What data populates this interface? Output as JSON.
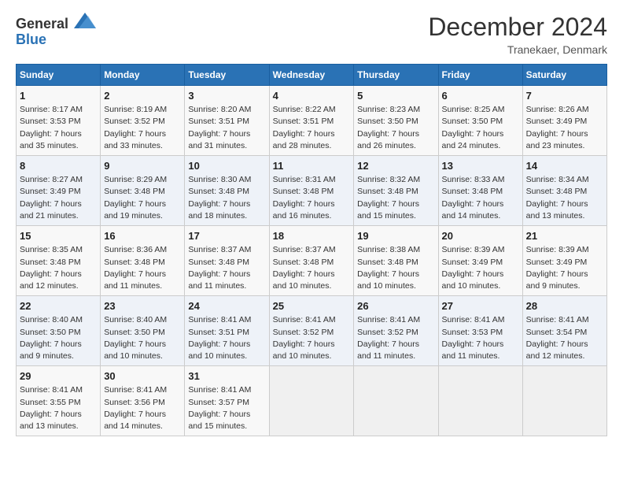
{
  "header": {
    "logo_general": "General",
    "logo_blue": "Blue",
    "month_year": "December 2024",
    "location": "Tranekaer, Denmark"
  },
  "weekdays": [
    "Sunday",
    "Monday",
    "Tuesday",
    "Wednesday",
    "Thursday",
    "Friday",
    "Saturday"
  ],
  "weeks": [
    [
      {
        "day": "1",
        "sunrise": "Sunrise: 8:17 AM",
        "sunset": "Sunset: 3:53 PM",
        "daylight": "Daylight: 7 hours and 35 minutes."
      },
      {
        "day": "2",
        "sunrise": "Sunrise: 8:19 AM",
        "sunset": "Sunset: 3:52 PM",
        "daylight": "Daylight: 7 hours and 33 minutes."
      },
      {
        "day": "3",
        "sunrise": "Sunrise: 8:20 AM",
        "sunset": "Sunset: 3:51 PM",
        "daylight": "Daylight: 7 hours and 31 minutes."
      },
      {
        "day": "4",
        "sunrise": "Sunrise: 8:22 AM",
        "sunset": "Sunset: 3:51 PM",
        "daylight": "Daylight: 7 hours and 28 minutes."
      },
      {
        "day": "5",
        "sunrise": "Sunrise: 8:23 AM",
        "sunset": "Sunset: 3:50 PM",
        "daylight": "Daylight: 7 hours and 26 minutes."
      },
      {
        "day": "6",
        "sunrise": "Sunrise: 8:25 AM",
        "sunset": "Sunset: 3:50 PM",
        "daylight": "Daylight: 7 hours and 24 minutes."
      },
      {
        "day": "7",
        "sunrise": "Sunrise: 8:26 AM",
        "sunset": "Sunset: 3:49 PM",
        "daylight": "Daylight: 7 hours and 23 minutes."
      }
    ],
    [
      {
        "day": "8",
        "sunrise": "Sunrise: 8:27 AM",
        "sunset": "Sunset: 3:49 PM",
        "daylight": "Daylight: 7 hours and 21 minutes."
      },
      {
        "day": "9",
        "sunrise": "Sunrise: 8:29 AM",
        "sunset": "Sunset: 3:48 PM",
        "daylight": "Daylight: 7 hours and 19 minutes."
      },
      {
        "day": "10",
        "sunrise": "Sunrise: 8:30 AM",
        "sunset": "Sunset: 3:48 PM",
        "daylight": "Daylight: 7 hours and 18 minutes."
      },
      {
        "day": "11",
        "sunrise": "Sunrise: 8:31 AM",
        "sunset": "Sunset: 3:48 PM",
        "daylight": "Daylight: 7 hours and 16 minutes."
      },
      {
        "day": "12",
        "sunrise": "Sunrise: 8:32 AM",
        "sunset": "Sunset: 3:48 PM",
        "daylight": "Daylight: 7 hours and 15 minutes."
      },
      {
        "day": "13",
        "sunrise": "Sunrise: 8:33 AM",
        "sunset": "Sunset: 3:48 PM",
        "daylight": "Daylight: 7 hours and 14 minutes."
      },
      {
        "day": "14",
        "sunrise": "Sunrise: 8:34 AM",
        "sunset": "Sunset: 3:48 PM",
        "daylight": "Daylight: 7 hours and 13 minutes."
      }
    ],
    [
      {
        "day": "15",
        "sunrise": "Sunrise: 8:35 AM",
        "sunset": "Sunset: 3:48 PM",
        "daylight": "Daylight: 7 hours and 12 minutes."
      },
      {
        "day": "16",
        "sunrise": "Sunrise: 8:36 AM",
        "sunset": "Sunset: 3:48 PM",
        "daylight": "Daylight: 7 hours and 11 minutes."
      },
      {
        "day": "17",
        "sunrise": "Sunrise: 8:37 AM",
        "sunset": "Sunset: 3:48 PM",
        "daylight": "Daylight: 7 hours and 11 minutes."
      },
      {
        "day": "18",
        "sunrise": "Sunrise: 8:37 AM",
        "sunset": "Sunset: 3:48 PM",
        "daylight": "Daylight: 7 hours and 10 minutes."
      },
      {
        "day": "19",
        "sunrise": "Sunrise: 8:38 AM",
        "sunset": "Sunset: 3:48 PM",
        "daylight": "Daylight: 7 hours and 10 minutes."
      },
      {
        "day": "20",
        "sunrise": "Sunrise: 8:39 AM",
        "sunset": "Sunset: 3:49 PM",
        "daylight": "Daylight: 7 hours and 10 minutes."
      },
      {
        "day": "21",
        "sunrise": "Sunrise: 8:39 AM",
        "sunset": "Sunset: 3:49 PM",
        "daylight": "Daylight: 7 hours and 9 minutes."
      }
    ],
    [
      {
        "day": "22",
        "sunrise": "Sunrise: 8:40 AM",
        "sunset": "Sunset: 3:50 PM",
        "daylight": "Daylight: 7 hours and 9 minutes."
      },
      {
        "day": "23",
        "sunrise": "Sunrise: 8:40 AM",
        "sunset": "Sunset: 3:50 PM",
        "daylight": "Daylight: 7 hours and 10 minutes."
      },
      {
        "day": "24",
        "sunrise": "Sunrise: 8:41 AM",
        "sunset": "Sunset: 3:51 PM",
        "daylight": "Daylight: 7 hours and 10 minutes."
      },
      {
        "day": "25",
        "sunrise": "Sunrise: 8:41 AM",
        "sunset": "Sunset: 3:52 PM",
        "daylight": "Daylight: 7 hours and 10 minutes."
      },
      {
        "day": "26",
        "sunrise": "Sunrise: 8:41 AM",
        "sunset": "Sunset: 3:52 PM",
        "daylight": "Daylight: 7 hours and 11 minutes."
      },
      {
        "day": "27",
        "sunrise": "Sunrise: 8:41 AM",
        "sunset": "Sunset: 3:53 PM",
        "daylight": "Daylight: 7 hours and 11 minutes."
      },
      {
        "day": "28",
        "sunrise": "Sunrise: 8:41 AM",
        "sunset": "Sunset: 3:54 PM",
        "daylight": "Daylight: 7 hours and 12 minutes."
      }
    ],
    [
      {
        "day": "29",
        "sunrise": "Sunrise: 8:41 AM",
        "sunset": "Sunset: 3:55 PM",
        "daylight": "Daylight: 7 hours and 13 minutes."
      },
      {
        "day": "30",
        "sunrise": "Sunrise: 8:41 AM",
        "sunset": "Sunset: 3:56 PM",
        "daylight": "Daylight: 7 hours and 14 minutes."
      },
      {
        "day": "31",
        "sunrise": "Sunrise: 8:41 AM",
        "sunset": "Sunset: 3:57 PM",
        "daylight": "Daylight: 7 hours and 15 minutes."
      },
      null,
      null,
      null,
      null
    ]
  ]
}
